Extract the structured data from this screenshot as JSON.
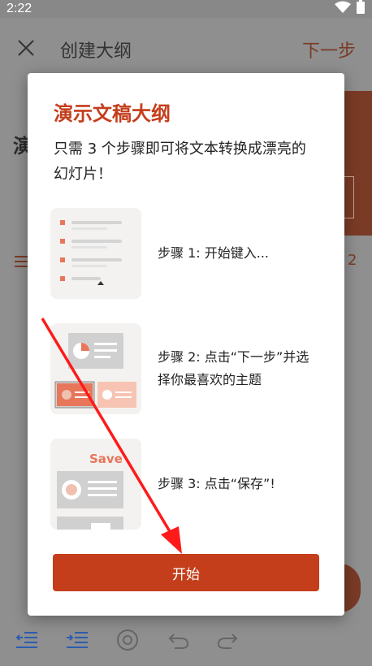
{
  "status_bar": {
    "time": "2:22"
  },
  "app_bar": {
    "title": "创建大纲",
    "next": "下一步"
  },
  "background": {
    "peek_text": "演",
    "page_num": "2"
  },
  "dialog": {
    "title": "演示文稿大纲",
    "subtitle": "只需 3 个步骤即可将文本转换成漂亮的幻灯片！",
    "steps": [
      {
        "text": "步骤 1: 开始键入..."
      },
      {
        "text": "步骤 2: 点击“下一步”并选择你最喜欢的主题"
      },
      {
        "text": "步骤 3: 点击“保存”!"
      }
    ],
    "step3_thumb_label": "Save",
    "start_button": "开始"
  },
  "colors": {
    "accent": "#c43e1c",
    "dim_accent": "#7a3b26",
    "scrim": "#8f8f8f"
  },
  "icons": [
    "close-icon",
    "wifi-icon",
    "battery-icon",
    "outdent-icon",
    "indent-icon",
    "mention-icon",
    "undo-icon",
    "redo-icon",
    "list-icon"
  ]
}
